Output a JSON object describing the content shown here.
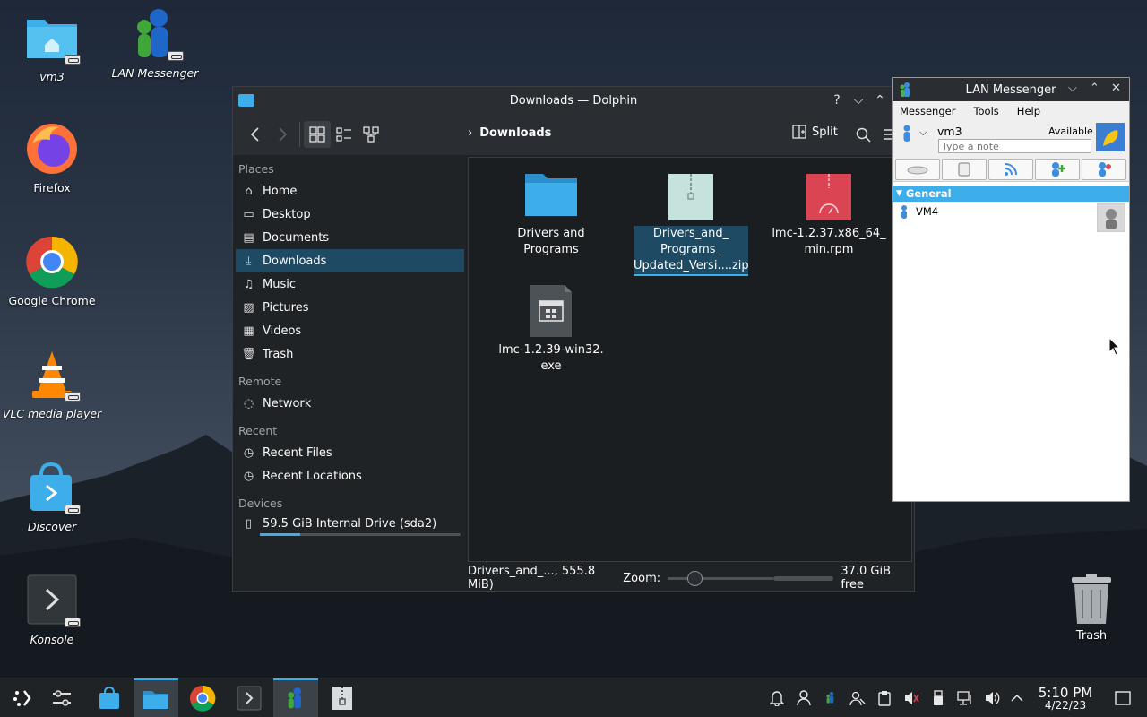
{
  "desktop": {
    "icons": [
      {
        "label": "vm3",
        "italic": true
      },
      {
        "label": "LAN Messenger",
        "italic": true
      },
      {
        "label": "Firefox",
        "italic": false
      },
      {
        "label": "Google Chrome",
        "italic": false
      },
      {
        "label": "VLC media player",
        "italic": true
      },
      {
        "label": "Discover",
        "italic": true
      },
      {
        "label": "Konsole",
        "italic": true
      }
    ],
    "trash_label": "Trash"
  },
  "dolphin": {
    "title": "Downloads — Dolphin",
    "help_glyph": "?",
    "breadcrumb": "Downloads",
    "split_label": "Split",
    "sidebar": {
      "places_heading": "Places",
      "places": [
        "Home",
        "Desktop",
        "Documents",
        "Downloads",
        "Music",
        "Pictures",
        "Videos",
        "Trash"
      ],
      "remote_heading": "Remote",
      "remote": [
        "Network"
      ],
      "recent_heading": "Recent",
      "recent": [
        "Recent Files",
        "Recent Locations"
      ],
      "devices_heading": "Devices",
      "devices": [
        "59.5 GiB Internal Drive (sda2)"
      ],
      "drive_used_fraction": 0.2
    },
    "files": [
      {
        "line1": "Drivers and",
        "line2": "Programs",
        "line3": ""
      },
      {
        "line1": "Drivers_and_",
        "line2": "Programs_",
        "line3": "Updated_Versi....zip"
      },
      {
        "line1": "lmc-1.2.37.x86_64_",
        "line2": "min.rpm",
        "line3": ""
      },
      {
        "line1": "lmc-1.2.39-win32.",
        "line2": "exe",
        "line3": ""
      }
    ],
    "status": {
      "selection": "Drivers_and_..., 555.8 MiB)",
      "zoom_label": "Zoom:",
      "free": "37.0 GiB free"
    }
  },
  "lan_messenger": {
    "title": "LAN Messenger",
    "menu": [
      "Messenger",
      "Tools",
      "Help"
    ],
    "user_name": "vm3",
    "status": "Available",
    "note_placeholder": "Type a note",
    "group": "General",
    "contacts": [
      "VM4"
    ]
  },
  "taskbar": {
    "time": "5:10 PM",
    "date": "4/22/23"
  },
  "colors": {
    "accent": "#3daee9",
    "selection": "#1e4a63",
    "window_bg": "#202326",
    "titlebar": "#2a2e32"
  }
}
